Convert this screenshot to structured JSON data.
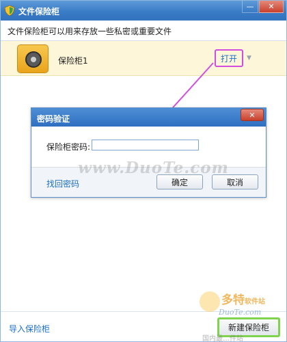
{
  "window": {
    "title": "文件保险柜",
    "subtitle": "文件保险柜可以用来存放一些私密或重要文件",
    "controls": {
      "minimize": "—",
      "close": "✕"
    }
  },
  "safes": [
    {
      "name": "保险柜1",
      "action_label": "打开",
      "menu_icon": "dropdown-caret"
    }
  ],
  "dialog": {
    "title": "密码验证",
    "close_label": "✕",
    "password_label": "保险柜密码:",
    "password_value": "",
    "recover_link": "找回密码",
    "ok_label": "确定",
    "cancel_label": "取消"
  },
  "watermark": {
    "text": "www.DuoTe.com",
    "brand": "多特",
    "brand_suffix": "软件站",
    "site": "DuoTe.com",
    "faint_text": "国内最…件站"
  },
  "footer": {
    "import_link": "导入保险柜",
    "new_safe_label": "新建保险柜"
  },
  "colors": {
    "titlebar": "#3a7cc6",
    "link": "#1a6fc6",
    "safe_row_bg": "#fdf6d9",
    "annotation_arrow": "#d24ddf",
    "highlight_green": "#7fd34f"
  }
}
